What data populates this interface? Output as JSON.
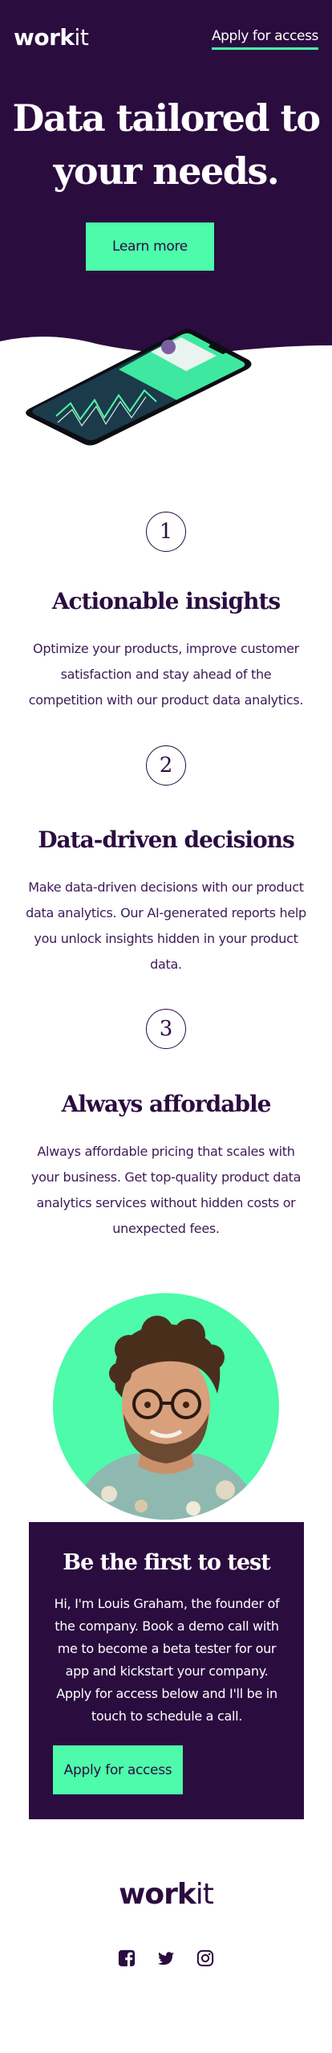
{
  "header": {
    "logo_bold": "work",
    "logo_light": "it",
    "link_label": "Apply for access"
  },
  "hero": {
    "title_line1": "Data tailored to",
    "title_line2": "your needs.",
    "button_label": "Learn more"
  },
  "features": [
    {
      "number": "1",
      "title": "Actionable insights",
      "text": "Optimize your products, improve customer satisfaction and stay ahead of the competition with our product data analytics."
    },
    {
      "number": "2",
      "title": "Data-driven decisions",
      "text": "Make data-driven decisions with our product data analytics. Our AI-generated reports help you unlock insights hidden in your product data."
    },
    {
      "number": "3",
      "title": "Always affordable",
      "text": "Always affordable pricing that scales with your business. Get top-quality product data analytics services without hidden costs or unexpected fees."
    }
  ],
  "cta": {
    "title": "Be the first to test",
    "text": "Hi, I'm Louis Graham, the founder of the company. Book a demo call with me to become a beta tester for our app and kickstart your company. Apply for access below and I'll be in touch to schedule a call.",
    "button_label": "Apply for access"
  },
  "footer": {
    "logo_bold": "work",
    "logo_light": "it",
    "social_icons": [
      "facebook-icon",
      "twitter-icon",
      "instagram-icon"
    ]
  },
  "colors": {
    "brand_dark": "#2b0c3f",
    "accent_green": "#4dfbaa",
    "white": "#ffffff"
  }
}
